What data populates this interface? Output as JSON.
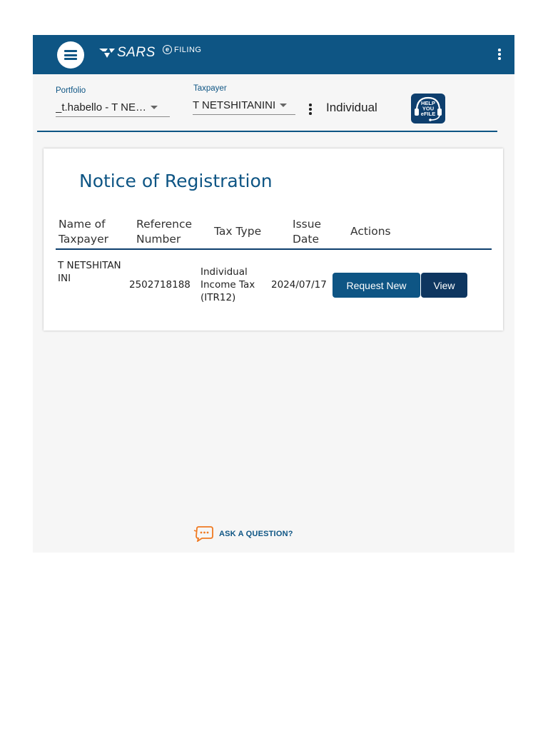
{
  "header": {
    "brand": "SARS",
    "efile_label": "FILING",
    "efile_icon": "e",
    "accent_color": "#0e5584"
  },
  "selectors": {
    "portfolio_label": "Portfolio",
    "portfolio_value": "_t.habello - T NE…",
    "taxpayer_label": "Taxpayer",
    "taxpayer_value": "T NETSHITANINI",
    "taxpayer_type": "Individual",
    "help_badge_lines": [
      "HELP",
      "YOU",
      "eFILE"
    ]
  },
  "card": {
    "title": "Notice of Registration",
    "columns": [
      "Name of Taxpayer",
      "Reference Number",
      "Tax Type",
      "Issue Date",
      "Actions"
    ],
    "rows": [
      {
        "name": "T NETSHITANINI",
        "reference": "2502718188",
        "tax_type": "Individual Income Tax (ITR12)",
        "issue_date": "2024/07/17",
        "actions": [
          "Request New",
          "View"
        ]
      }
    ]
  },
  "footer": {
    "ask_label": "ASK A QUESTION?"
  }
}
